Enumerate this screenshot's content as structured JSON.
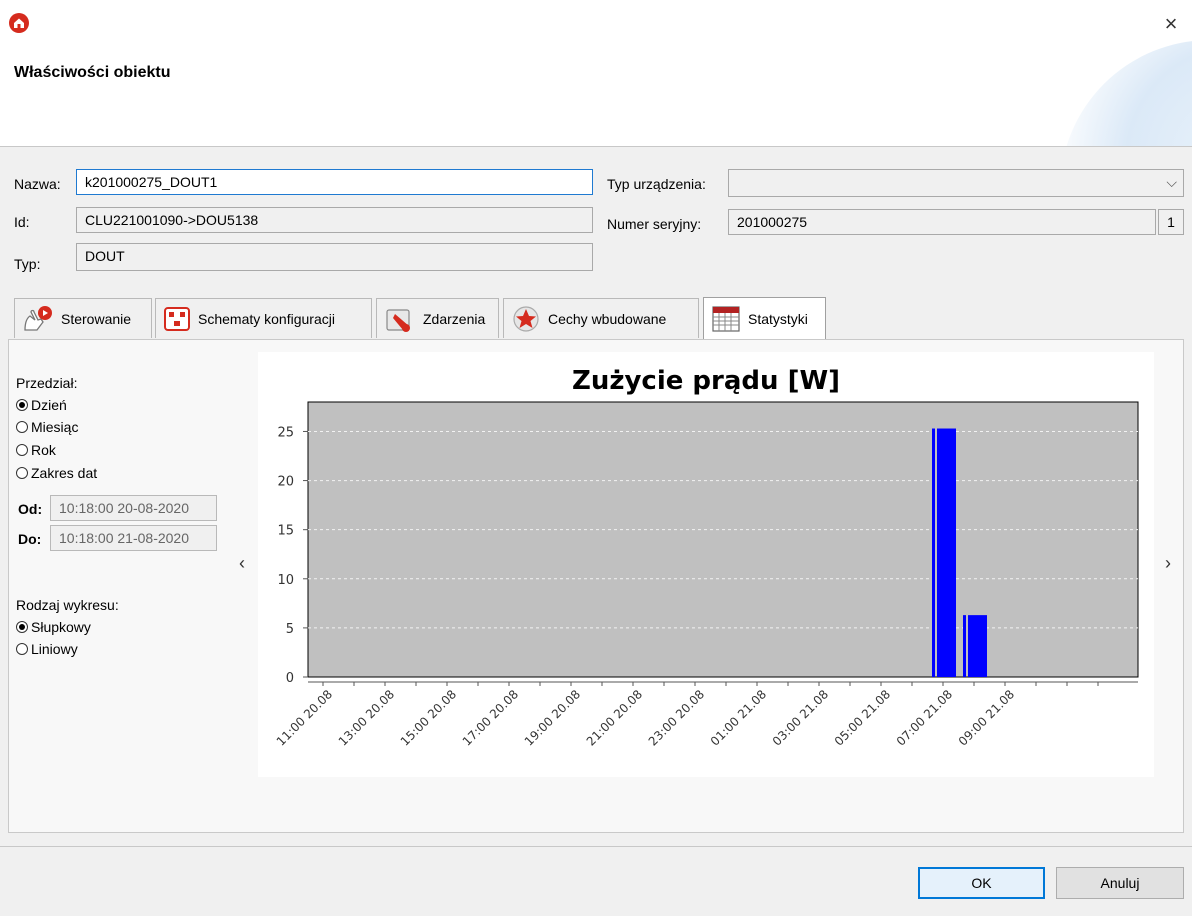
{
  "dialog": {
    "title": "Właściwości obiektu",
    "close_glyph": "×"
  },
  "fields": {
    "name_label": "Nazwa:",
    "name_value": "k201000275_DOUT1",
    "id_label": "Id:",
    "id_value": "CLU221001090->DOU5138",
    "type_label": "Typ:",
    "type_value": "DOUT",
    "device_type_label": "Typ urządzenia:",
    "device_type_value": "",
    "serial_label": "Numer seryjny:",
    "serial_value": "201000275",
    "serial_suffix": "1"
  },
  "tabs": [
    {
      "label": "Sterowanie",
      "icon": "hand-touch-icon",
      "active": false
    },
    {
      "label": "Schematy konfiguracji",
      "icon": "schema-icon",
      "active": false
    },
    {
      "label": "Zdarzenia",
      "icon": "events-icon",
      "active": false
    },
    {
      "label": "Cechy wbudowane",
      "icon": "star-icon",
      "active": false
    },
    {
      "label": "Statystyki",
      "icon": "calendar-grid-icon",
      "active": true
    }
  ],
  "stats": {
    "range_label": "Przedział:",
    "range_options": [
      "Dzień",
      "Miesiąc",
      "Rok",
      "Zakres dat"
    ],
    "range_selected": "Dzień",
    "from_label": "Od:",
    "from_value": "10:18:00  20-08-2020",
    "to_label": "Do:",
    "to_value": "10:18:00  21-08-2020",
    "chart_kind_label": "Rodzaj wykresu:",
    "chart_kind_options": [
      "Słupkowy",
      "Liniowy"
    ],
    "chart_kind_selected": "Słupkowy",
    "prev_glyph": "‹",
    "next_glyph": "›"
  },
  "chart_data": {
    "type": "bar",
    "title": "Zużycie prądu [W]",
    "xlabel": "",
    "ylabel": "",
    "ylim": [
      0,
      28
    ],
    "yticks": [
      0,
      5,
      10,
      15,
      20,
      25
    ],
    "xticks": [
      "11:00 20.08",
      "13:00 20.08",
      "15:00 20.08",
      "17:00 20.08",
      "19:00 20.08",
      "21:00 20.08",
      "23:00 20.08",
      "01:00 21.08",
      "03:00 21.08",
      "05:00 21.08",
      "07:00 21.08",
      "09:00 21.08"
    ],
    "bars": [
      {
        "time": "07:00 21.08",
        "value": 25.3
      },
      {
        "time": "08:00 21.08",
        "value": 6.3
      }
    ],
    "grid": true,
    "plot_background": "#c0c0c0",
    "bar_color": "#0000ff"
  },
  "buttons": {
    "ok": "OK",
    "cancel": "Anuluj"
  },
  "colors": {
    "accent": "#0078d7",
    "logo": "#d52b1e"
  }
}
